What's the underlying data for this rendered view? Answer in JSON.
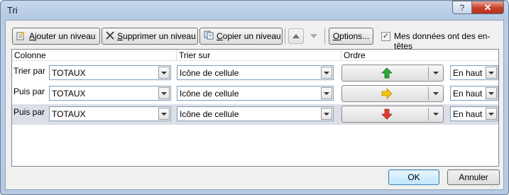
{
  "window": {
    "title": "Tri",
    "help_label": "?",
    "close_label": "✕"
  },
  "toolbar": {
    "add_level": {
      "underline": "A",
      "rest": "jouter un niveau",
      "icon": "add-level-icon"
    },
    "delete_level": {
      "underline": "S",
      "rest": "upprimer un niveau",
      "icon": "delete-x-icon"
    },
    "copy_level": {
      "underline": "C",
      "rest": "opier un niveau",
      "icon": "copy-icon"
    },
    "move_up_icon": "up-arrow-icon",
    "move_down_icon": "down-arrow-icon",
    "options": {
      "underline": "O",
      "rest": "ptions..."
    },
    "headers_checkbox": {
      "checked": true,
      "mark": "✓",
      "text_before": "Mes données ont des en-",
      "underline": "t",
      "text_after": "êtes"
    }
  },
  "columns": {
    "colonne": "Colonne",
    "trier_sur": "Trier sur",
    "ordre": "Ordre"
  },
  "rows": [
    {
      "label": "Trier par",
      "column": "TOTAUX",
      "sort_on": "Icône de cellule",
      "order_icon": "green-up-arrow-icon",
      "order_color": "#2fa83a",
      "position": "En haut",
      "selected": false
    },
    {
      "label": "Puis par",
      "column": "TOTAUX",
      "sort_on": "Icône de cellule",
      "order_icon": "yellow-right-arrow-icon",
      "order_color": "#f2c40f",
      "position": "En haut",
      "selected": false
    },
    {
      "label": "Puis par",
      "column": "TOTAUX",
      "sort_on": "Icône de cellule",
      "order_icon": "red-down-arrow-icon",
      "order_color": "#e23b2e",
      "position": "En haut",
      "selected": true
    }
  ],
  "footer": {
    "ok": "OK",
    "cancel": "Annuler"
  }
}
